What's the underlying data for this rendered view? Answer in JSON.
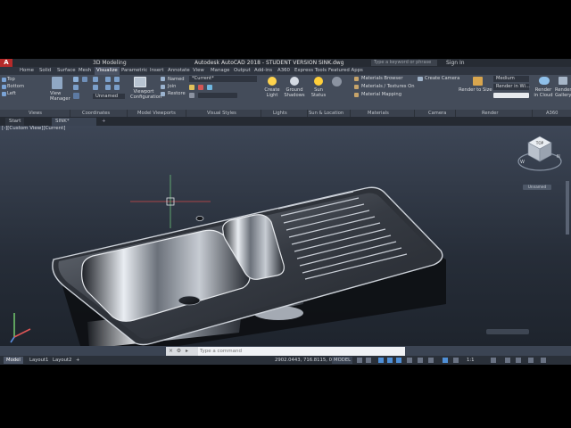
{
  "title_bar": {
    "app_icon": "A",
    "workspace": "3D Modeling",
    "title": "Autodesk AutoCAD 2018 - STUDENT VERSION    SINK.dwg",
    "search_placeholder": "Type a keyword or phrase",
    "sign_in": "Sign In"
  },
  "ribbon_tabs": [
    "Home",
    "Solid",
    "Surface",
    "Mesh",
    "Visualize",
    "Parametric",
    "Insert",
    "Annotate",
    "View",
    "Manage",
    "Output",
    "Add-ins",
    "A360",
    "Express Tools",
    "Featured Apps"
  ],
  "active_tab": "Visualize",
  "ribbon": {
    "views": {
      "top": "Top",
      "bottom": "Bottom",
      "left": "Left"
    },
    "view_manager": "View Manager",
    "coordinates_ucs": "Unnamed",
    "viewport_config": "Viewport Configuration",
    "named": "Named",
    "join": "Join",
    "restore": "Restore",
    "visual_style": "*Current*",
    "create_light": "Create Light",
    "ground_shadows": "Ground Shadows",
    "sun_status": "Sun Status",
    "materials_browser": "Materials Browser",
    "materials_textures": "Materials / Textures On",
    "material_mapping": "Material Mapping",
    "create_camera": "Create Camera",
    "render_to_size": "Render to Size",
    "render_quality": "Medium",
    "render_in": "Render in Wi...",
    "render_in_cloud": "Render in Cloud",
    "render_gallery": "Render Gallery"
  },
  "panel_titles": [
    "Views",
    "Coordinates",
    "Model Viewports",
    "Visual Styles",
    "Lights",
    "Sun & Location",
    "Materials",
    "Camera",
    "Render",
    "A360"
  ],
  "file_tabs": {
    "start": "Start",
    "current": "SINK*",
    "add": "+"
  },
  "viewport": {
    "label": "[-][Custom View][Current]",
    "viewcube_face": "TOP",
    "wcs": "Unnamed"
  },
  "command_line": {
    "placeholder": "Type a command"
  },
  "status_bar": {
    "layout_tabs": [
      "Model",
      "Layout1",
      "Layout2"
    ],
    "add_layout": "+",
    "coordinates": "2902.0443, 716.8115, 0.0000",
    "mode": "MODEL",
    "scale": "1:1"
  },
  "colors": {
    "titlebar_bg": "#262b33",
    "ribbon_bg": "#444c5a",
    "viewport_bg": "#3d4656",
    "accent_red": "#b52a2a",
    "sink_steel": "#9aa1ab"
  },
  "icons": [
    "autocad-logo-icon",
    "viewcube-icon",
    "ucs-axis-icon",
    "crosshair-icon",
    "sun-icon",
    "light-bulb-icon",
    "camera-icon",
    "teapot-icon",
    "cloud-icon"
  ]
}
